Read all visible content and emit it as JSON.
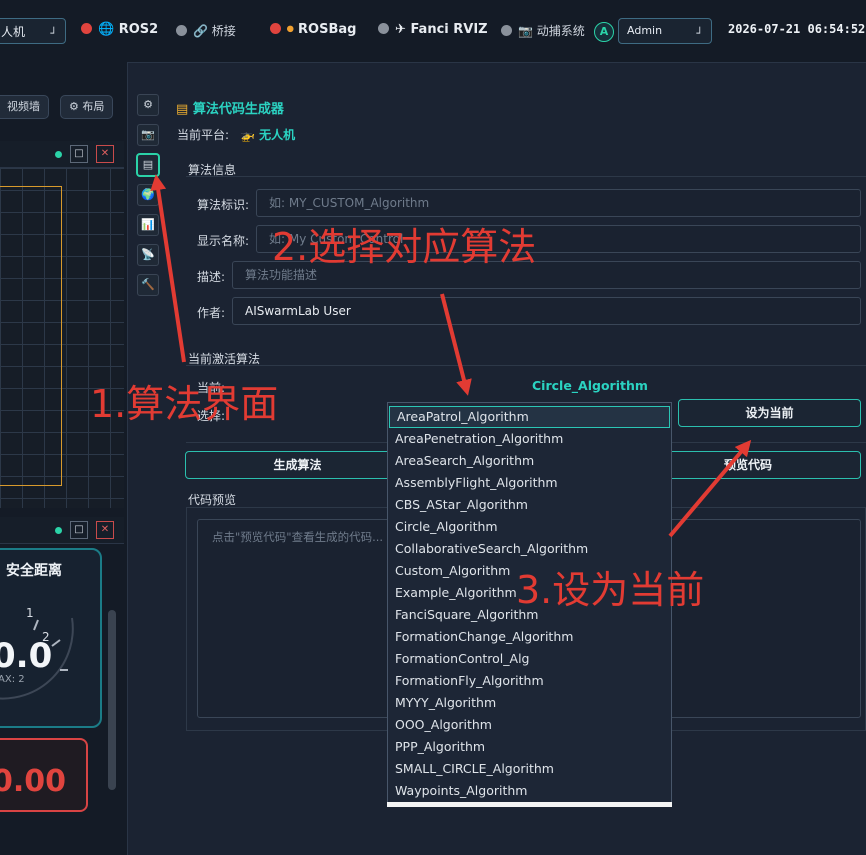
{
  "topbar": {
    "platform_select": "人机",
    "ros2": "ROS2",
    "bridge": "桥接",
    "rosbag": "ROSBag",
    "rviz": "Fanci RVIZ",
    "mocap": "动捕系统",
    "avatar_letter": "A",
    "user_select": "Admin",
    "datetime": "2026-07-21 06:54:52"
  },
  "left_panel": {
    "video_wall_button": "视频墙",
    "layout_button": "布局",
    "gauge_title": "安全距离",
    "gauge_value": "0.0",
    "gauge_tick_1": "1",
    "gauge_tick_2": "2",
    "gauge_max": "AX: 2",
    "red_value": "0.00"
  },
  "main": {
    "title": "算法代码生成器",
    "platform_label": "当前平台:",
    "platform_value": "无人机",
    "info_section": "算法信息",
    "id_label": "算法标识:",
    "id_placeholder": "如: MY_CUSTOM_Algorithm",
    "name_label": "显示名称:",
    "name_placeholder": "如: My Custom Control",
    "desc_label": "描述:",
    "desc_placeholder": "算法功能描述",
    "author_label": "作者:",
    "author_value": "AISwarmLab User",
    "active_section": "当前激活算法",
    "current_label": "当前:",
    "current_value": "Circle_Algorithm",
    "select_label": "选择:",
    "set_current_button": "设为当前",
    "generate_button": "生成算法",
    "preview_button": "预览代码",
    "code_section": "代码预览",
    "code_placeholder": "点击\"预览代码\"查看生成的代码..."
  },
  "dropdown_options": [
    "AreaPatrol_Algorithm",
    "AreaPenetration_Algorithm",
    "AreaSearch_Algorithm",
    "AssemblyFlight_Algorithm",
    "CBS_AStar_Algorithm",
    "Circle_Algorithm",
    "CollaborativeSearch_Algorithm",
    "Custom_Algorithm",
    "Example_Algorithm",
    "FanciSquare_Algorithm",
    "FormationChange_Algorithm",
    "FormationControl_Alg",
    "FormationFly_Algorithm",
    "MYYY_Algorithm",
    "OOO_Algorithm",
    "PPP_Algorithm",
    "SMALL_CIRCLE_Algorithm",
    "Waypoints_Algorithm"
  ],
  "annotations": {
    "step1": "1.算法界面",
    "step2": "2.选择对应算法",
    "step3": "3.设为当前"
  },
  "colors": {
    "accent_teal": "#2bd3a8",
    "status_red": "#e0443e",
    "status_gray": "#8a919b",
    "annotation_red": "#e23b33"
  }
}
